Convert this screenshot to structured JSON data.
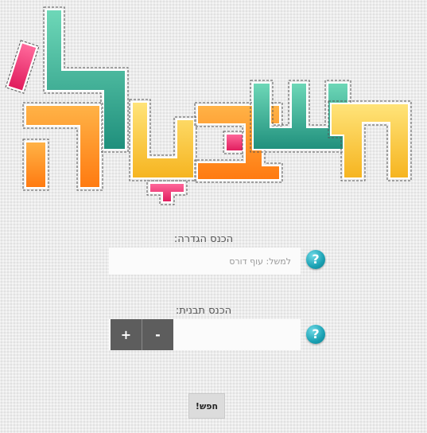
{
  "definition": {
    "label": "הכנס הגדרה:",
    "placeholder": "למשל: עוף דורס",
    "value": ""
  },
  "pattern": {
    "label": "הכנס תבנית:",
    "plus_label": "+",
    "minus_label": "-"
  },
  "help_label": "?",
  "search_label": "חפש!",
  "logo": {
    "colors": {
      "teal": "#2aa28e",
      "orange": "#ff8a1f",
      "yellow": "#fbc536",
      "pink": "#ee3b77"
    }
  }
}
